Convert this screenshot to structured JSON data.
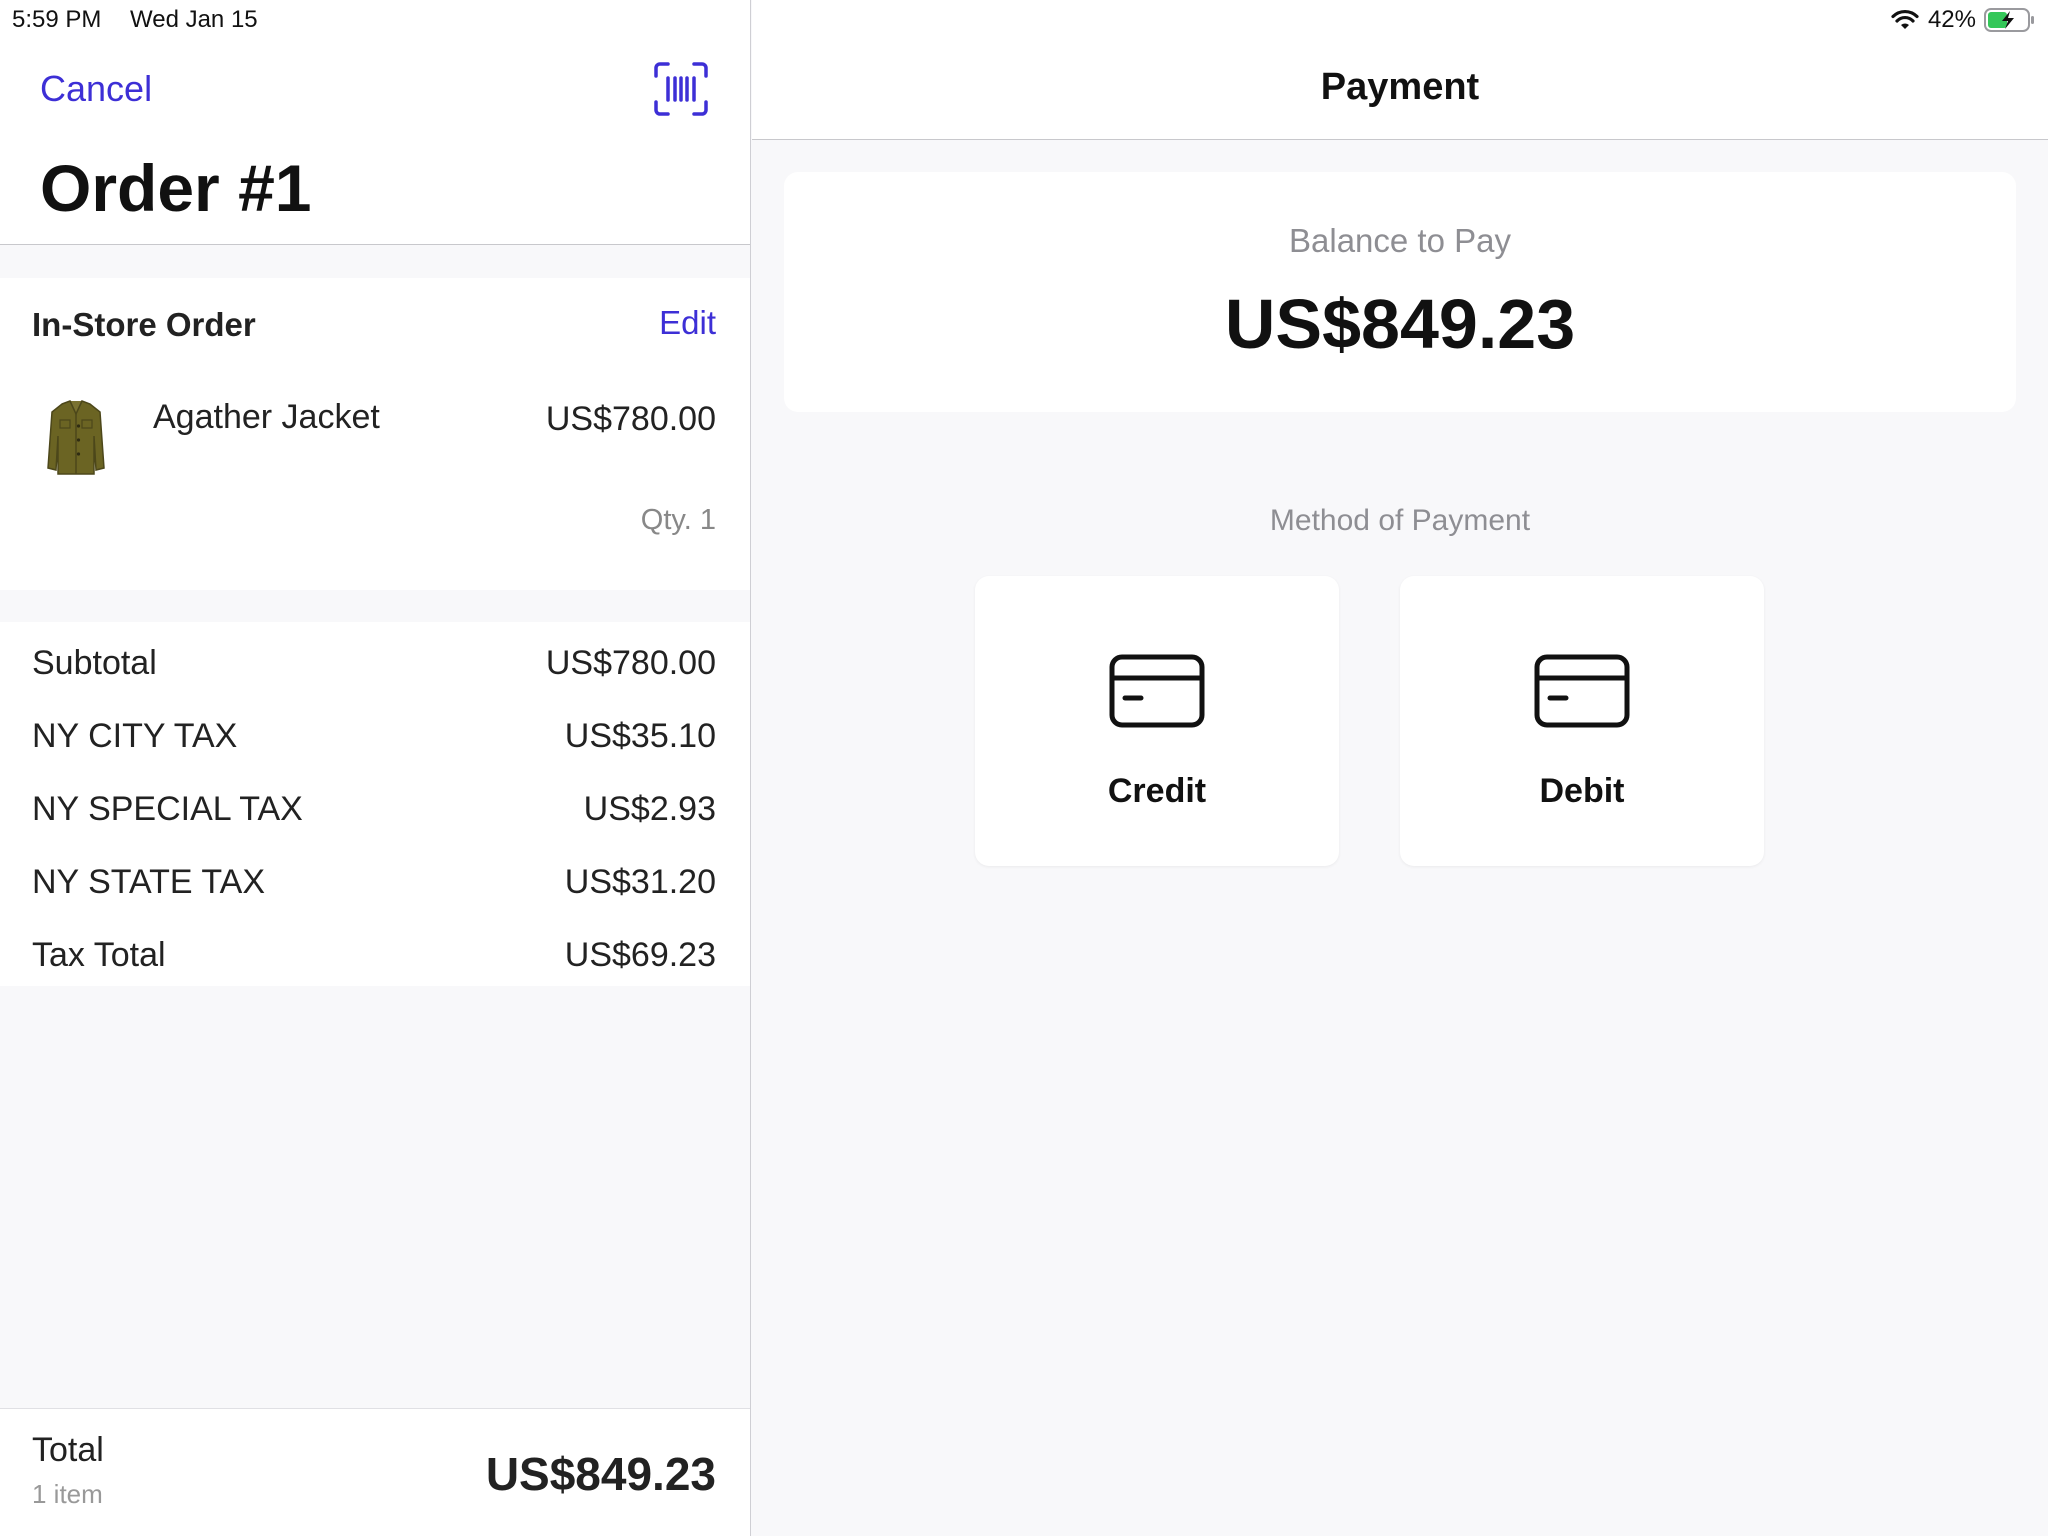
{
  "status_bar": {
    "time": "5:59 PM",
    "date": "Wed Jan 15",
    "battery": "42%"
  },
  "left": {
    "cancel_label": "Cancel",
    "title": "Order #1",
    "order_card": {
      "title": "In-Store Order",
      "edit_label": "Edit",
      "item": {
        "name": "Agather Jacket",
        "price": "US$780.00",
        "qty": "Qty. 1"
      }
    },
    "summary": [
      {
        "label": "Subtotal",
        "value": "US$780.00"
      },
      {
        "label": "NY CITY TAX",
        "value": "US$35.10"
      },
      {
        "label": "NY SPECIAL TAX",
        "value": "US$2.93"
      },
      {
        "label": "NY STATE TAX",
        "value": "US$31.20"
      },
      {
        "label": "Tax Total",
        "value": "US$69.23"
      }
    ],
    "total": {
      "label": "Total",
      "count": "1 item",
      "value": "US$849.23"
    }
  },
  "right": {
    "title": "Payment",
    "balance_label": "Balance to Pay",
    "balance_value": "US$849.23",
    "method_label": "Method of Payment",
    "options": [
      {
        "label": "Credit",
        "icon": "credit-card-icon"
      },
      {
        "label": "Debit",
        "icon": "credit-card-icon"
      }
    ]
  },
  "colors": {
    "accent": "#3d2fd6",
    "background": "#f8f8fa",
    "muted_text": "#8e8e93",
    "battery_green": "#34c759"
  }
}
